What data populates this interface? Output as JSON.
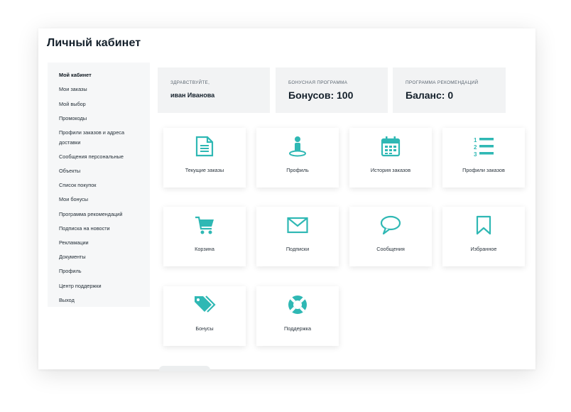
{
  "page_title": "Личный кабинет",
  "sidebar": {
    "items": [
      {
        "label": "Мой кабинет",
        "active": true
      },
      {
        "label": "Мои заказы"
      },
      {
        "label": "Мой выбор"
      },
      {
        "label": "Промокоды"
      },
      {
        "label": "Профили заказов и адреса"
      },
      {
        "label": "доставки"
      },
      {
        "label": "Сообщения персональные"
      },
      {
        "label": "Объекты"
      },
      {
        "label": "Список покупок"
      },
      {
        "label": "Мои бонусы"
      },
      {
        "label": "Программа рекомендаций"
      },
      {
        "label": "Подписка на новости"
      },
      {
        "label": "Рекламации"
      },
      {
        "label": "Документы"
      },
      {
        "label": "Профиль"
      },
      {
        "label": "Центр поддержки"
      },
      {
        "label": "Выход"
      }
    ]
  },
  "info": {
    "greeting_caption": "Здравствуйте,",
    "greeting_name": "иван Иванова",
    "bonus_caption": "Бонусная программа",
    "bonus_value": "Бонусов: 100",
    "referral_caption": "Программа рекомендаций",
    "referral_value": "Баланс: 0"
  },
  "tiles": [
    {
      "label": "Текущие заказы",
      "icon": "document-icon"
    },
    {
      "label": "Профиль",
      "icon": "user-pin-icon"
    },
    {
      "label": "История заказов",
      "icon": "calendar-icon"
    },
    {
      "label": "Профили заказов",
      "icon": "numbered-list-icon"
    },
    {
      "label": "Корзина",
      "icon": "cart-icon"
    },
    {
      "label": "Подписки",
      "icon": "envelope-icon"
    },
    {
      "label": "Сообщения",
      "icon": "speech-bubble-icon"
    },
    {
      "label": "Избранное",
      "icon": "bookmark-icon"
    },
    {
      "label": "Бонусы",
      "icon": "tags-icon"
    },
    {
      "label": "Поддержка",
      "icon": "lifebuoy-icon"
    }
  ],
  "colors": {
    "accent": "#2fb8b4",
    "sidebar_bg": "#f6f7f8",
    "info_bg": "#f2f3f4"
  }
}
